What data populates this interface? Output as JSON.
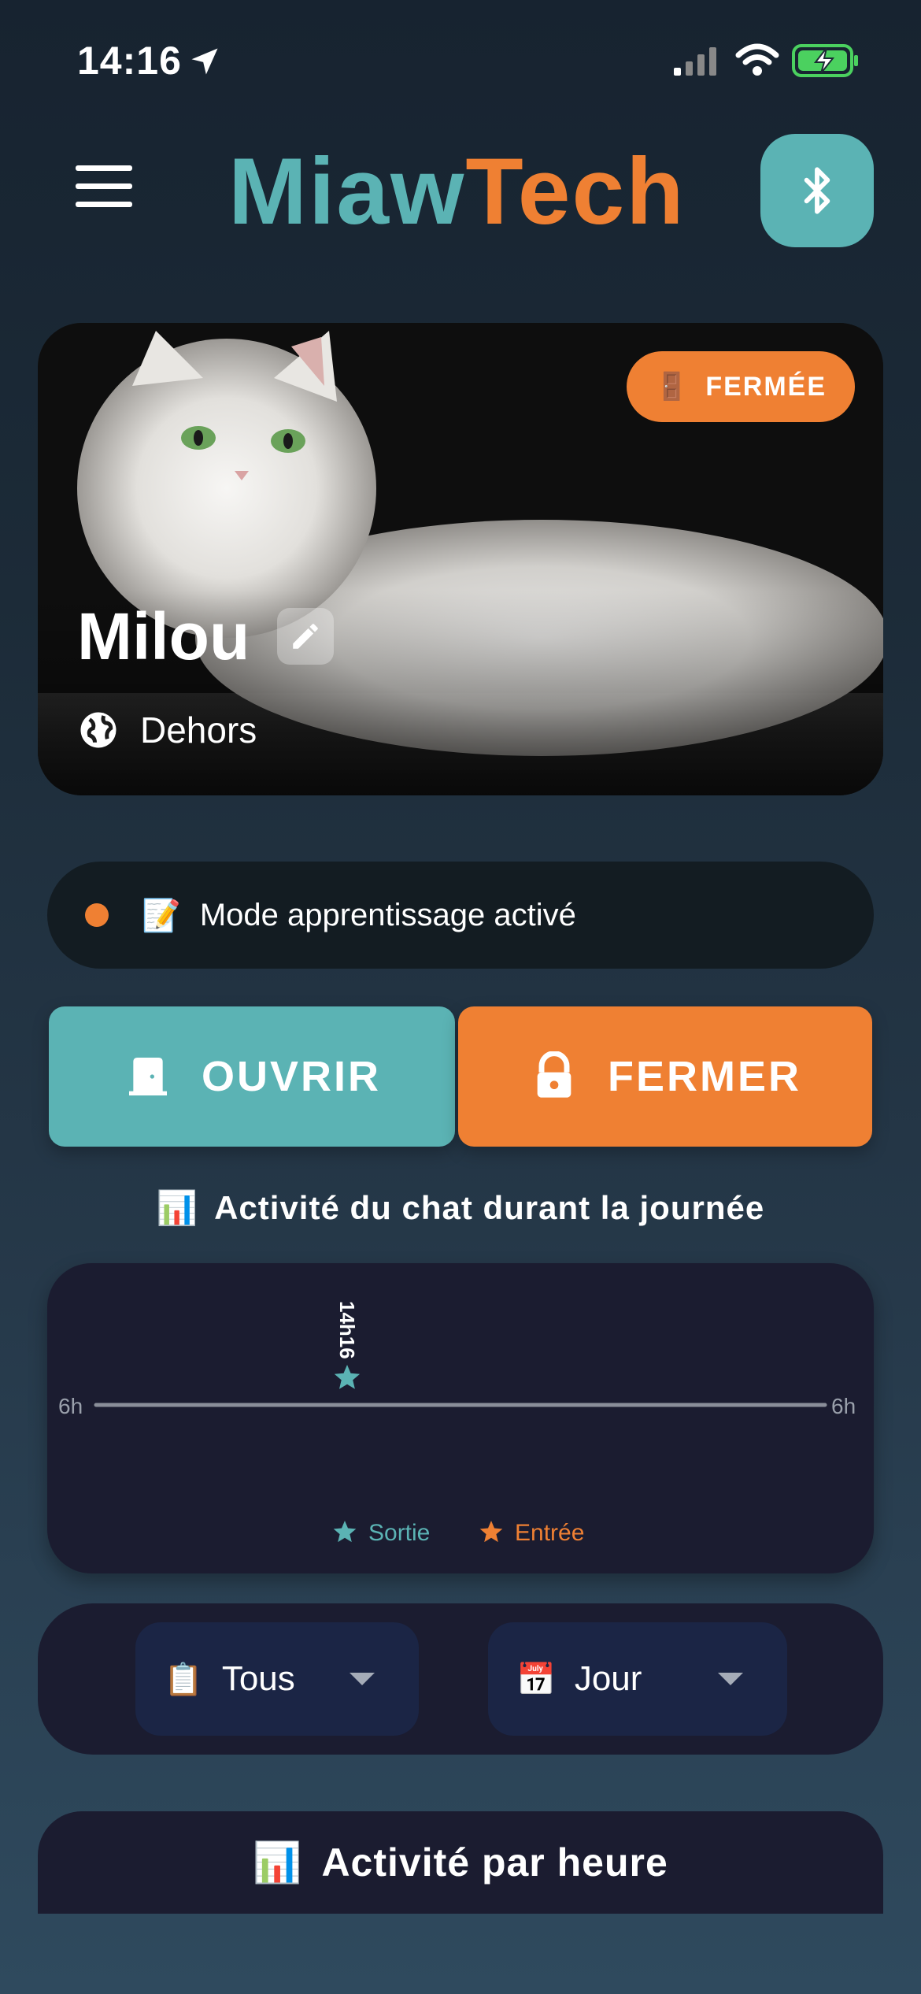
{
  "status_bar": {
    "time": "14:16"
  },
  "header": {
    "brand_part1": "Miaw",
    "brand_part2": "Tech"
  },
  "cat": {
    "name": "Milou",
    "door_status": "FERMÉE",
    "location": "Dehors"
  },
  "mode": {
    "text": "Mode apprentissage activé"
  },
  "actions": {
    "open_label": "OUVRIR",
    "close_label": "FERMER"
  },
  "timeline_section": {
    "title": "Activité du chat durant la journée"
  },
  "chart_data": {
    "type": "scatter",
    "x_axis_left_label": "6h",
    "x_axis_right_label": "6h",
    "series": [
      {
        "name": "Sortie",
        "color": "#5bb3b4",
        "points": [
          {
            "time": "14h16",
            "label": "14h16"
          }
        ]
      },
      {
        "name": "Entrée",
        "color": "#ef8033",
        "points": []
      }
    ]
  },
  "filters": {
    "type_value": "Tous",
    "type_icon": "clipboard-icon",
    "period_value": "Jour",
    "period_icon": "calendar-icon"
  },
  "hourly_section": {
    "title": "Activité par heure"
  },
  "colors": {
    "accent_teal": "#5bb3b4",
    "accent_orange": "#ef8033"
  }
}
